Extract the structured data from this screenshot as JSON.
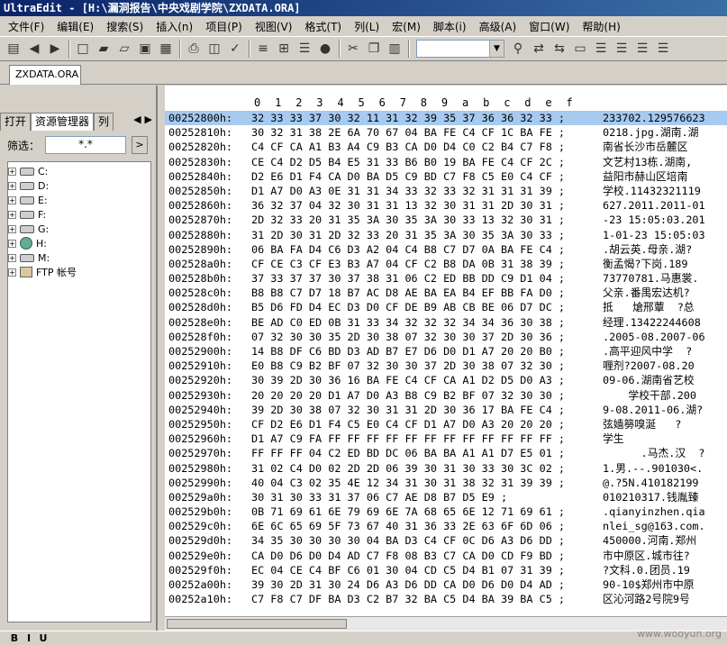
{
  "window": {
    "title": "UltraEdit - [H:\\漏洞报告\\中央戏剧学院\\ZXDATA.ORA]"
  },
  "menu": [
    "文件(F)",
    "编辑(E)",
    "搜索(S)",
    "插入(n)",
    "项目(P)",
    "视图(V)",
    "格式(T)",
    "列(L)",
    "宏(M)",
    "脚本(i)",
    "高级(A)",
    "窗口(W)",
    "帮助(H)"
  ],
  "toolbar": {
    "icons": [
      "new-file-icon",
      "back-arrow-icon",
      "forward-arrow-icon",
      "new-icon",
      "open-folder-icon",
      "open-icon",
      "close-icon",
      "save-icon",
      "print-icon",
      "print-preview-icon",
      "spell-check-icon",
      "format-icon",
      "hex-mode-icon",
      "properties-icon",
      "browser-icon",
      "cut-icon",
      "copy-icon",
      "paste-icon",
      "find-icon",
      "replace-icon",
      "find-prev-icon",
      "compare-icon",
      "align-left-icon",
      "align-center-icon",
      "align-right-icon",
      "justify-icon"
    ],
    "combo_value": ""
  },
  "file_tabs": [
    {
      "label": "ZXDATA.ORA"
    }
  ],
  "left_panel": {
    "tabs": [
      "打开",
      "资源管理器",
      "列"
    ],
    "active_tab": "资源管理器",
    "filter_label": "筛选：",
    "filter_value": "*.*",
    "tree": [
      {
        "label": "C:",
        "icon": "drive-icon"
      },
      {
        "label": "D:",
        "icon": "drive-icon"
      },
      {
        "label": "E:",
        "icon": "drive-icon"
      },
      {
        "label": "F:",
        "icon": "drive-icon"
      },
      {
        "label": "G:",
        "icon": "drive-icon"
      },
      {
        "label": "H:",
        "icon": "network-drive-icon"
      },
      {
        "label": "M:",
        "icon": "drive-icon"
      },
      {
        "label": "FTP 帐号",
        "icon": "ftp-icon"
      }
    ]
  },
  "hex": {
    "ruler": [
      "0",
      "1",
      "2",
      "3",
      "4",
      "5",
      "6",
      "7",
      "8",
      "9",
      "a",
      "b",
      "c",
      "d",
      "e",
      "f"
    ],
    "rows": [
      {
        "addr": "00252800h:",
        "bytes": "32 33 33 37 30 32 11 31 32 39 35 37 36 36 32 33 ;",
        "text": "233702.129576623"
      },
      {
        "addr": "00252810h:",
        "bytes": "30 32 31 38 2E 6A 70 67 04 BA FE C4 CF 1C BA FE ;",
        "text": "0218.jpg.湖南.湖"
      },
      {
        "addr": "00252820h:",
        "bytes": "C4 CF CA A1 B3 A4 C9 B3 CA D0 D4 C0 C2 B4 C7 F8 ;",
        "text": "南省长沙市岳麓区"
      },
      {
        "addr": "00252830h:",
        "bytes": "CE C4 D2 D5 B4 E5 31 33 B6 B0 19 BA FE C4 CF 2C ;",
        "text": "文艺村13栋.湖南,"
      },
      {
        "addr": "00252840h:",
        "bytes": "D2 E6 D1 F4 CA D0 BA D5 C9 BD C7 F8 C5 E0 C4 CF ;",
        "text": "益阳市赫山区培南"
      },
      {
        "addr": "00252850h:",
        "bytes": "D1 A7 D0 A3 0E 31 31 34 33 32 33 32 31 31 31 39 ;",
        "text": "学校.11432321119"
      },
      {
        "addr": "00252860h:",
        "bytes": "36 32 37 04 32 30 31 31 13 32 30 31 31 2D 30 31 ;",
        "text": "627.2011.2011-01"
      },
      {
        "addr": "00252870h:",
        "bytes": "2D 32 33 20 31 35 3A 30 35 3A 30 33 13 32 30 31 ;",
        "text": "-23 15:05:03.201"
      },
      {
        "addr": "00252880h:",
        "bytes": "31 2D 30 31 2D 32 33 20 31 35 3A 30 35 3A 30 33 ;",
        "text": "1-01-23 15:05:03"
      },
      {
        "addr": "00252890h:",
        "bytes": "06 BA FA D4 C6 D3 A2 04 C4 B8 C7 D7 0A BA FE C4 ;",
        "text": ".胡云英.母亲.湖?"
      },
      {
        "addr": "002528a0h:",
        "bytes": "CF CE C3 CF E3 B3 A7 04 CF C2 B8 DA 0B 31 38 39 ;",
        "text": "衡孟愒?下岗.189"
      },
      {
        "addr": "002528b0h:",
        "bytes": "37 33 37 37 30 37 38 31 06 C2 ED BB DD C9 D1 04 ;",
        "text": "73770781.马惠裳."
      },
      {
        "addr": "002528c0h:",
        "bytes": "B8 B8 C7 D7 18 B7 AC D8 AE BA EA B4 EF BB FA D0 ;",
        "text": "父亲.番禺宏达机?"
      },
      {
        "addr": "002528d0h:",
        "bytes": "B5 D6 FD D4 EC D3 D0 CF DE B9 AB CB BE 06 D7 DC ;",
        "text": "抵   熗邢蕈  ?总"
      },
      {
        "addr": "002528e0h:",
        "bytes": "BE AD C0 ED 0B 31 33 34 32 32 32 34 34 36 30 38 ;",
        "text": "经理.13422244608"
      },
      {
        "addr": "002528f0h:",
        "bytes": "07 32 30 30 35 2D 30 38 07 32 30 30 37 2D 30 36 ;",
        "text": ".2005-08.2007-06"
      },
      {
        "addr": "00252900h:",
        "bytes": "14 B8 DF C6 BD D3 AD B7 E7 D6 D0 D1 A7 20 20 B0 ;",
        "text": ".高平迎风中学  ?"
      },
      {
        "addr": "00252910h:",
        "bytes": "E0 B8 C9 B2 BF 07 32 30 30 37 2D 30 38 07 32 30 ;",
        "text": "喱剂?2007-08.20"
      },
      {
        "addr": "00252920h:",
        "bytes": "30 39 2D 30 36 16 BA FE C4 CF CA A1 D2 D5 D0 A3 ;",
        "text": "09-06.湖南省艺校"
      },
      {
        "addr": "00252930h:",
        "bytes": "20 20 20 20 D1 A7 D0 A3 B8 C9 B2 BF 07 32 30 30 ;",
        "text": "    学校干部.200"
      },
      {
        "addr": "00252940h:",
        "bytes": "39 2D 30 38 07 32 30 31 31 2D 30 36 17 BA FE C4 ;",
        "text": "9-08.2011-06.湖?"
      },
      {
        "addr": "00252950h:",
        "bytes": "CF D2 E6 D1 F4 C5 E0 C4 CF D1 A7 D0 A3 20 20 20 ;",
        "text": "弦嫱簩嗅涎   ?"
      },
      {
        "addr": "00252960h:",
        "bytes": "D1 A7 C9 FA FF FF FF FF FF FF FF FF FF FF FF FF ;",
        "text": "学生"
      },
      {
        "addr": "00252970h:",
        "bytes": "FF FF FF 04 C2 ED BD DC 06 BA BA A1 A1 D7 E5 01 ;",
        "text": "      .马杰.汉  ?"
      },
      {
        "addr": "00252980h:",
        "bytes": "31 02 C4 D0 02 2D 2D 06 39 30 31 30 33 30 3C 02 ;",
        "text": "1.男.--.901030<."
      },
      {
        "addr": "00252990h:",
        "bytes": "40 04 C3 02 35 4E 12 34 31 30 31 38 32 31 39 39 ;",
        "text": "@.?5N.410182199"
      },
      {
        "addr": "002529a0h:",
        "bytes": "30 31 30 33 31 37 06 C7 AE D8 B7 D5 E9 ;",
        "text": "010210317.钱胤臻"
      },
      {
        "addr": "002529b0h:",
        "bytes": "0B 71 69 61 6E 79 69 6E 7A 68 65 6E 12 71 69 61 ;",
        "text": ".qianyinzhen.qia"
      },
      {
        "addr": "002529c0h:",
        "bytes": "6E 6C 65 69 5F 73 67 40 31 36 33 2E 63 6F 6D 06 ;",
        "text": "nlei_sg@163.com."
      },
      {
        "addr": "002529d0h:",
        "bytes": "34 35 30 30 30 30 04 BA D3 C4 CF 0C D6 A3 D6 DD ;",
        "text": "450000.河南.郑州"
      },
      {
        "addr": "002529e0h:",
        "bytes": "CA D0 D6 D0 D4 AD C7 F8 08 B3 C7 CA D0 CD F9 BD ;",
        "text": "市中原区.城市往?"
      },
      {
        "addr": "002529f0h:",
        "bytes": "EC 04 CE C4 BF C6 01 30 04 CD C5 D4 B1 07 31 39 ;",
        "text": "?文科.0.团员.19"
      },
      {
        "addr": "00252a00h:",
        "bytes": "39 30 2D 31 30 24 D6 A3 D6 DD CA D0 D6 D0 D4 AD ;",
        "text": "90-10$郑州市中原"
      },
      {
        "addr": "00252a10h:",
        "bytes": "C7 F8 C7 DF BA D3 C2 B7 32 BA C5 D4 BA 39 BA C5 ;",
        "text": "区沁河路2号院9号"
      }
    ]
  },
  "bottom_bar": {
    "buttons": [
      "B",
      "I",
      "U"
    ]
  },
  "watermark": "www.wooyun.org"
}
